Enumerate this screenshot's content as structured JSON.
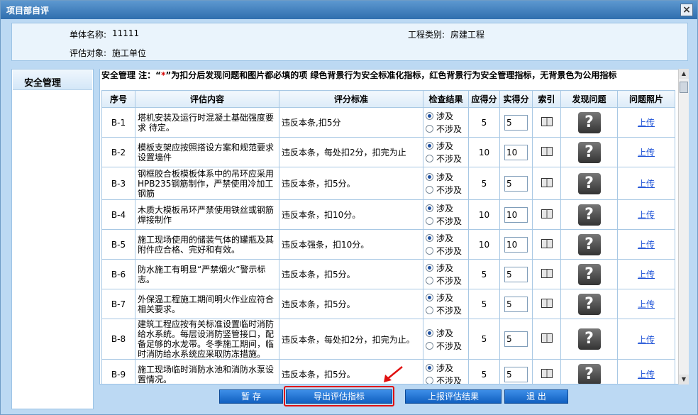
{
  "window": {
    "title": "项目部自评",
    "close_label": "×"
  },
  "info": {
    "unit_name_label": "单体名称:",
    "unit_name_value": "11111",
    "project_type_label": "工程类别:",
    "project_type_value": "房建工程",
    "target_label": "评估对象:",
    "target_value": "施工单位"
  },
  "sidebar": {
    "items": [
      {
        "label": "安全管理"
      }
    ]
  },
  "notice": {
    "prefix": "安全管理   注：“",
    "star": "*",
    "suffix": "”为扣分后发现问题和图片都必填的项  绿色背景行为安全标准化指标，红色背景行为安全管理指标，无背景色为公用指标"
  },
  "table": {
    "headers": [
      "序号",
      "评估内容",
      "评分标准",
      "检查结果",
      "应得分",
      "实得分",
      "索引",
      "发现问题",
      "问题照片"
    ],
    "radio_labels": [
      "涉及",
      "不涉及"
    ],
    "upload_label": "上传",
    "rows": [
      {
        "id": "B-1",
        "content": "塔机安装及运行时混凝土基础强度要求 待定。",
        "standard": "违反本条,扣5分",
        "due": "5",
        "actual": "5"
      },
      {
        "id": "B-2",
        "content": "模板支架应按照搭设方案和规范要求设置墙件",
        "standard": "违反本条，每处扣2分，扣完为止",
        "due": "10",
        "actual": "10"
      },
      {
        "id": "B-3",
        "content": "钢框胶合板模板体系中的吊环应采用HPB235钢筋制作，严禁使用冷加工钢筋",
        "standard": "违反本条，扣5分。",
        "due": "5",
        "actual": "5"
      },
      {
        "id": "B-4",
        "content": "木质大模板吊环严禁使用铁丝或钢筋焊接制作",
        "standard": "违反本条，扣10分。",
        "due": "10",
        "actual": "10"
      },
      {
        "id": "B-5",
        "content": "施工现场使用的储装气体的罐瓶及其附件应合格、完好和有效。",
        "standard": "违反本强条，扣10分。",
        "due": "10",
        "actual": "10"
      },
      {
        "id": "B-6",
        "content": "防水施工有明显“严禁烟火”警示标志。",
        "standard": "违反本条，扣5分。",
        "due": "5",
        "actual": "5"
      },
      {
        "id": "B-7",
        "content": "外保温工程施工期间明火作业应符合相关要求。",
        "standard": "违反本条，扣5分。",
        "due": "5",
        "actual": "5"
      },
      {
        "id": "B-8",
        "content": "建筑工程应按有关标准设置临时消防给水系统。每层设消防竖管接口，配备足够的水龙带。冬季施工期间，临时消防给水系统应采取防冻措施。",
        "standard": "违反本条，每处扣2分，扣完为止。",
        "due": "5",
        "actual": "5"
      },
      {
        "id": "B-9",
        "content": "施工现场临时消防水池和消防水泵设置情况。",
        "standard": "违反本条，扣5分。",
        "due": "5",
        "actual": "5"
      }
    ]
  },
  "buttons": {
    "save": "暂 存",
    "export": "导出评估指标",
    "report": "上报评估结果",
    "exit": "退 出"
  },
  "colors": {
    "accent": "#1160c0",
    "highlight": "#e01010",
    "link": "#1a4fd6"
  }
}
